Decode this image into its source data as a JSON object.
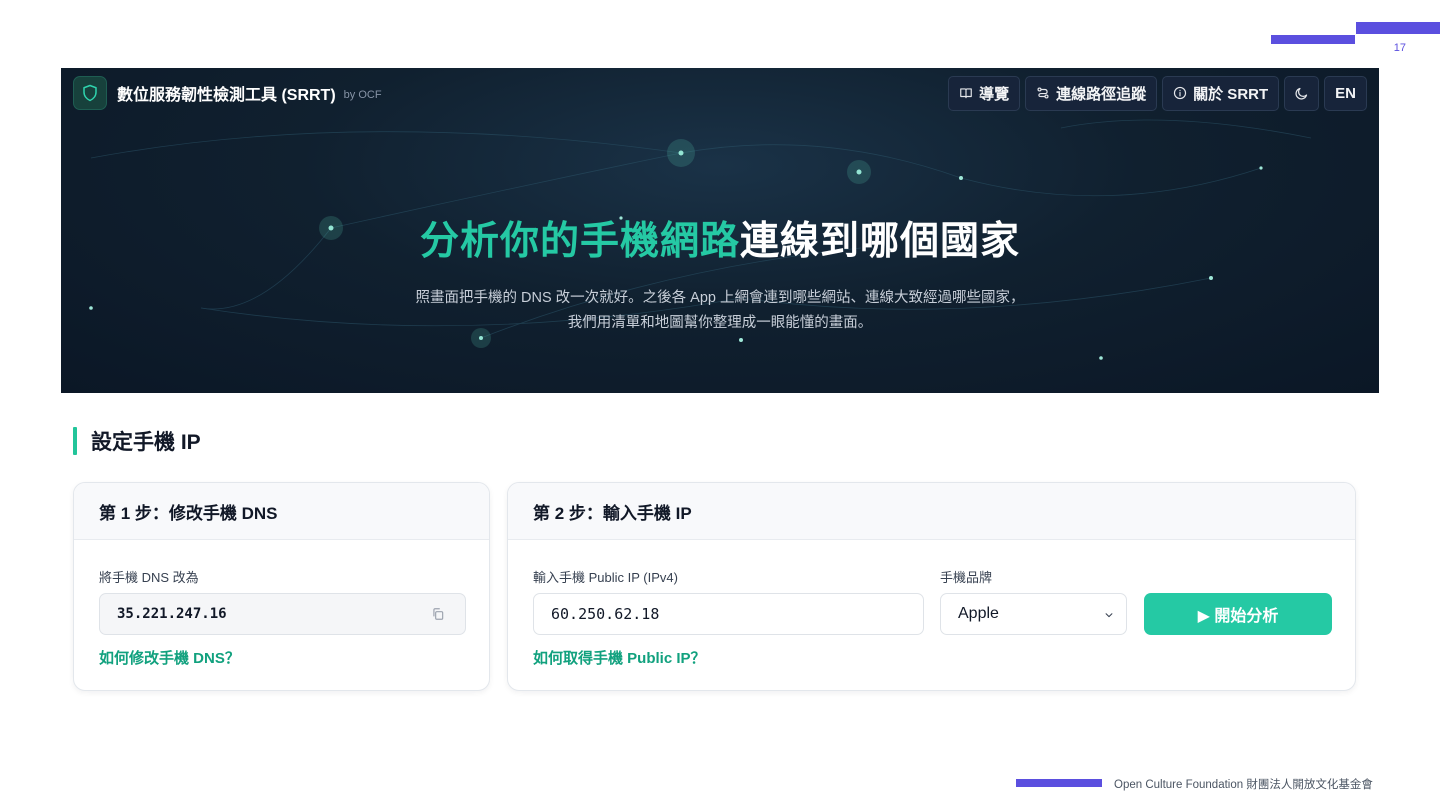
{
  "slide": {
    "page_number": "17",
    "footer": "Open Culture Foundation 財團法人開放文化基金會",
    "accent_color": "#5b4fdf"
  },
  "app": {
    "brand": {
      "title": "數位服務韌性檢測工具 (SRRT)",
      "by": "by OCF",
      "logo_icon": "shield-icon"
    },
    "nav": {
      "guide": {
        "label": "導覽",
        "icon": "book-icon"
      },
      "trace": {
        "label": "連線路徑追蹤",
        "icon": "route-icon"
      },
      "about": {
        "label": "關於 SRRT",
        "icon": "info-icon"
      },
      "theme_icon": "moon-icon",
      "lang": "EN"
    },
    "hero": {
      "title_accent": "分析你的手機網路",
      "title_rest": "連線到哪個國家",
      "subtitle_line1": "照畫面把手機的 DNS 改一次就好。之後各 App 上網會連到哪些網站、連線大致經過哪些國家，",
      "subtitle_line2": "我們用清單和地圖幫你整理成一眼能懂的畫面。"
    },
    "colors": {
      "accent": "#25c9a4",
      "link": "#11a17e",
      "hero_bg": "#0f1b2e"
    }
  },
  "section": {
    "title": "設定手機 IP",
    "step1": {
      "title": "第 1 步：修改手機 DNS",
      "dns_label": "將手機 DNS 改為",
      "dns_value": "35.221.247.16",
      "copy_icon": "copy-icon",
      "help_link": "如何修改手機 DNS？"
    },
    "step2": {
      "title": "第 2 步：輸入手機 IP",
      "ip_label": "輸入手機 Public IP (IPv4)",
      "ip_value": "60.250.62.18",
      "brand_label": "手機品牌",
      "brand_selected": "Apple",
      "start_label": "▶ 開始分析",
      "help_link": "如何取得手機 Public IP？"
    }
  }
}
